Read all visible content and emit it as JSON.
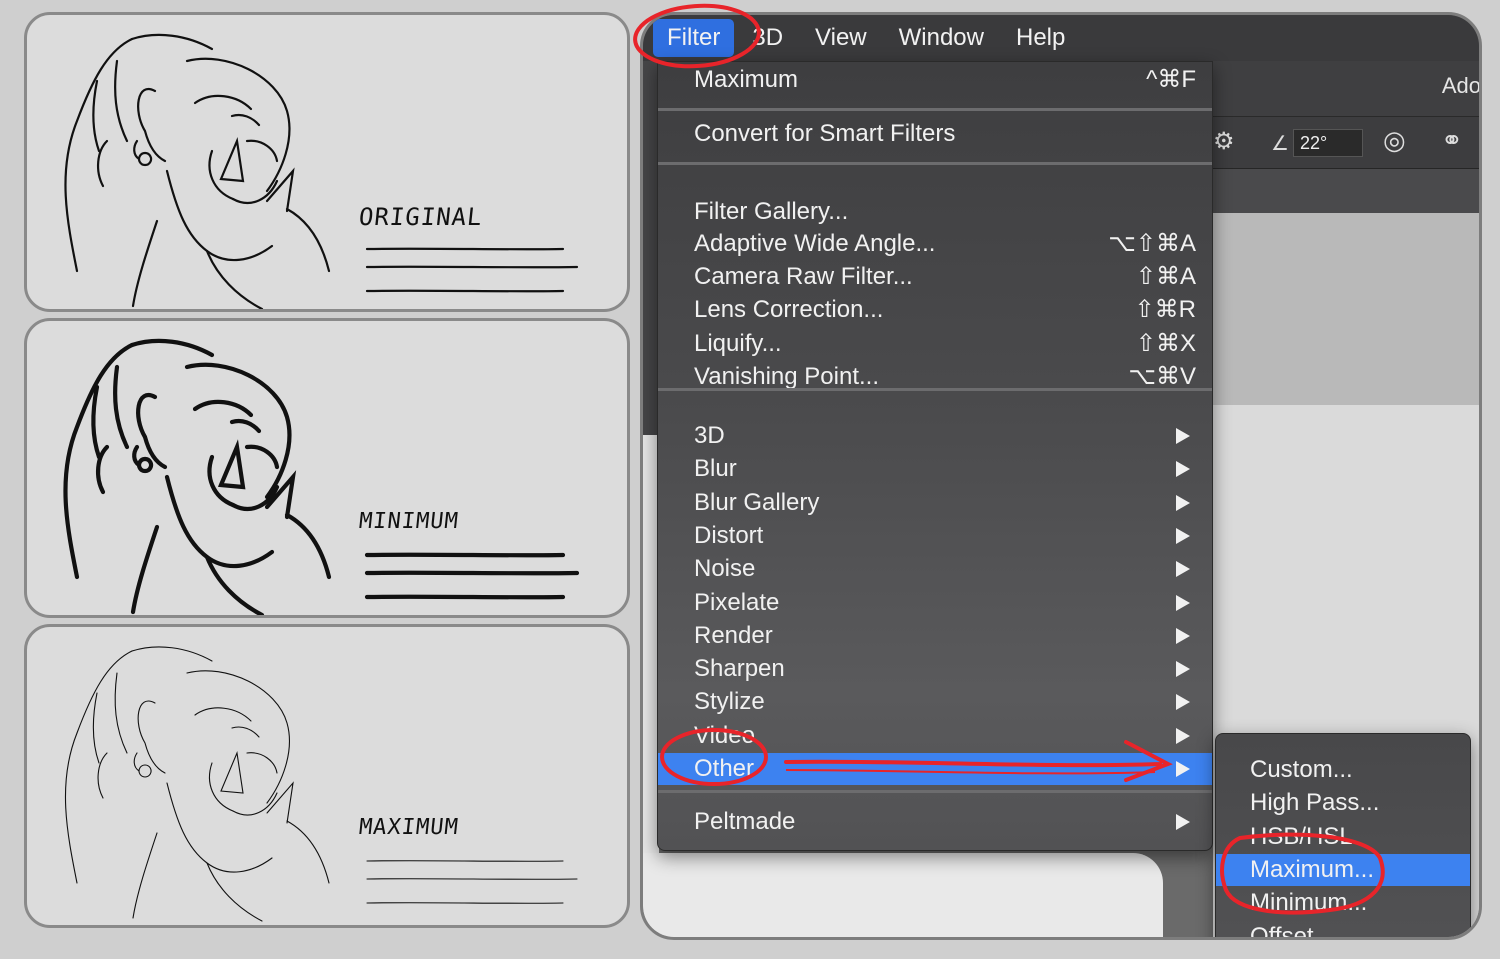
{
  "panels": [
    {
      "caption": "ORIGINAL",
      "line_weight": 2.2,
      "caption_size": 24
    },
    {
      "caption": "MINIMUM",
      "line_weight": 4.2,
      "caption_size": 22
    },
    {
      "caption": "MAXIMUM",
      "line_weight": 1.1,
      "caption_size": 22
    }
  ],
  "menubar": {
    "items": [
      "Filter",
      "3D",
      "View",
      "Window",
      "Help"
    ],
    "active": "Filter"
  },
  "app": {
    "title_partial": "Ado",
    "angle_value": "22°"
  },
  "filter_menu": {
    "top": [
      {
        "label": "Maximum",
        "shortcut": "^⌘F"
      }
    ],
    "smart": [
      {
        "label": "Convert for Smart Filters",
        "shortcut": ""
      }
    ],
    "gallery": [
      {
        "label": "Filter Gallery...",
        "shortcut": ""
      },
      {
        "label": "Adaptive Wide Angle...",
        "shortcut": "⌥⇧⌘A"
      },
      {
        "label": "Camera Raw Filter...",
        "shortcut": "⇧⌘A"
      },
      {
        "label": "Lens Correction...",
        "shortcut": "⇧⌘R"
      },
      {
        "label": "Liquify...",
        "shortcut": "⇧⌘X"
      },
      {
        "label": "Vanishing Point...",
        "shortcut": "⌥⌘V"
      }
    ],
    "submenus": [
      "3D",
      "Blur",
      "Blur Gallery",
      "Distort",
      "Noise",
      "Pixelate",
      "Render",
      "Sharpen",
      "Stylize",
      "Video",
      "Other"
    ],
    "highlighted": "Other",
    "plugins": [
      "Peltmade"
    ]
  },
  "other_submenu": {
    "items": [
      "Custom...",
      "High Pass...",
      "HSB/HSL",
      "Maximum...",
      "Minimum...",
      "Offset..."
    ],
    "highlighted": "Maximum..."
  },
  "colors": {
    "accent": "#3d82f0",
    "annotation_red": "#e8242a"
  }
}
